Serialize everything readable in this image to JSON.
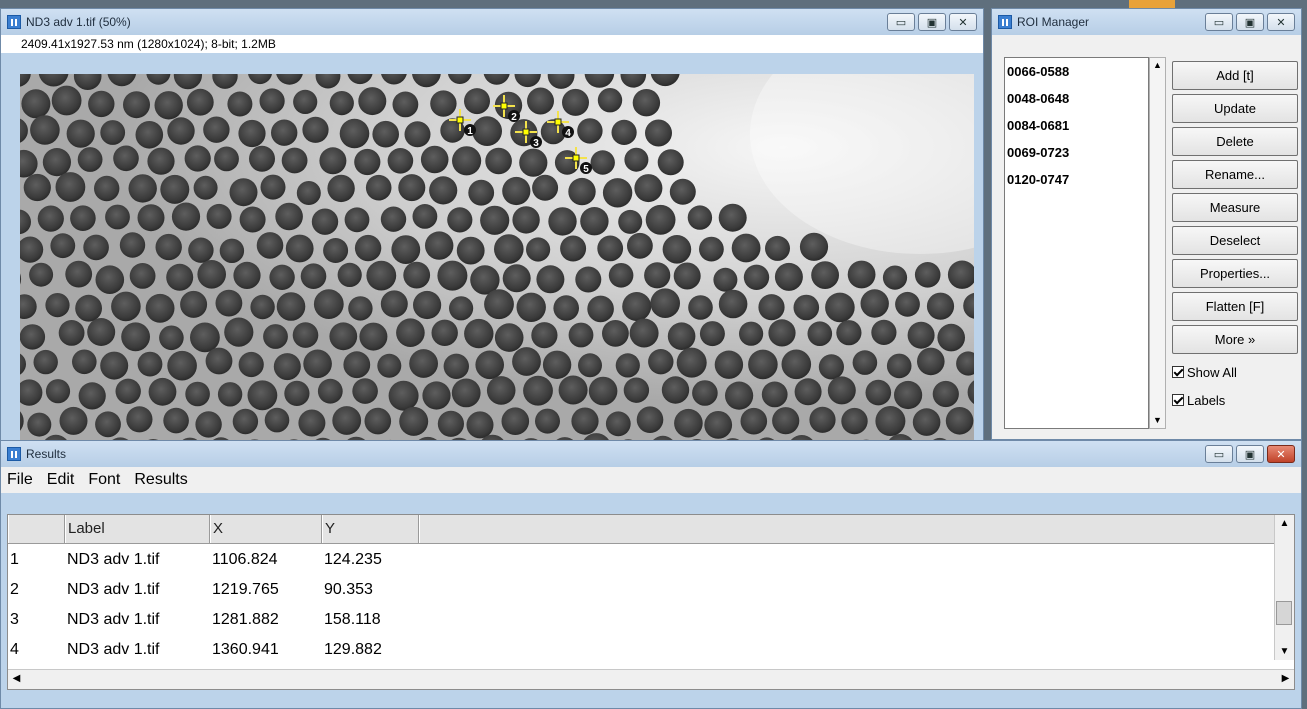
{
  "image_window": {
    "title": "ND3 adv 1.tif (50%)",
    "info": "2409.41x1927.53 nm (1280x1024); 8-bit; 1.2MB",
    "controls": [
      "▭",
      "▣",
      "✕"
    ],
    "markers": [
      {
        "label": "1"
      },
      {
        "label": "2"
      },
      {
        "label": "3"
      },
      {
        "label": "4"
      },
      {
        "label": "5"
      }
    ]
  },
  "roi_manager": {
    "title": "ROI Manager",
    "controls": [
      "▭",
      "▣",
      "✕"
    ],
    "items": [
      "0066-0588",
      "0048-0648",
      "0084-0681",
      "0069-0723",
      "0120-0747"
    ],
    "buttons": [
      "Add [t]",
      "Update",
      "Delete",
      "Rename...",
      "Measure",
      "Deselect",
      "Properties...",
      "Flatten [F]",
      "More »"
    ],
    "checkboxes": [
      {
        "label": "Show All",
        "checked": true
      },
      {
        "label": "Labels",
        "checked": true
      }
    ]
  },
  "results": {
    "title": "Results",
    "controls": [
      "▭",
      "▣",
      "✕"
    ],
    "menu": [
      "File",
      "Edit",
      "Font",
      "Results"
    ],
    "columns": [
      "",
      "Label",
      "X",
      "Y",
      ""
    ],
    "rows": [
      [
        "1",
        "ND3 adv 1.tif",
        "1106.824",
        "124.235"
      ],
      [
        "2",
        "ND3 adv 1.tif",
        "1219.765",
        "90.353"
      ],
      [
        "3",
        "ND3 adv 1.tif",
        "1281.882",
        "158.118"
      ],
      [
        "4",
        "ND3 adv 1.tif",
        "1360.941",
        "129.882"
      ]
    ]
  },
  "colors": {
    "marker": "#f3e24c",
    "window_title": "#bcd3ea",
    "close_red": "#c0432a"
  }
}
